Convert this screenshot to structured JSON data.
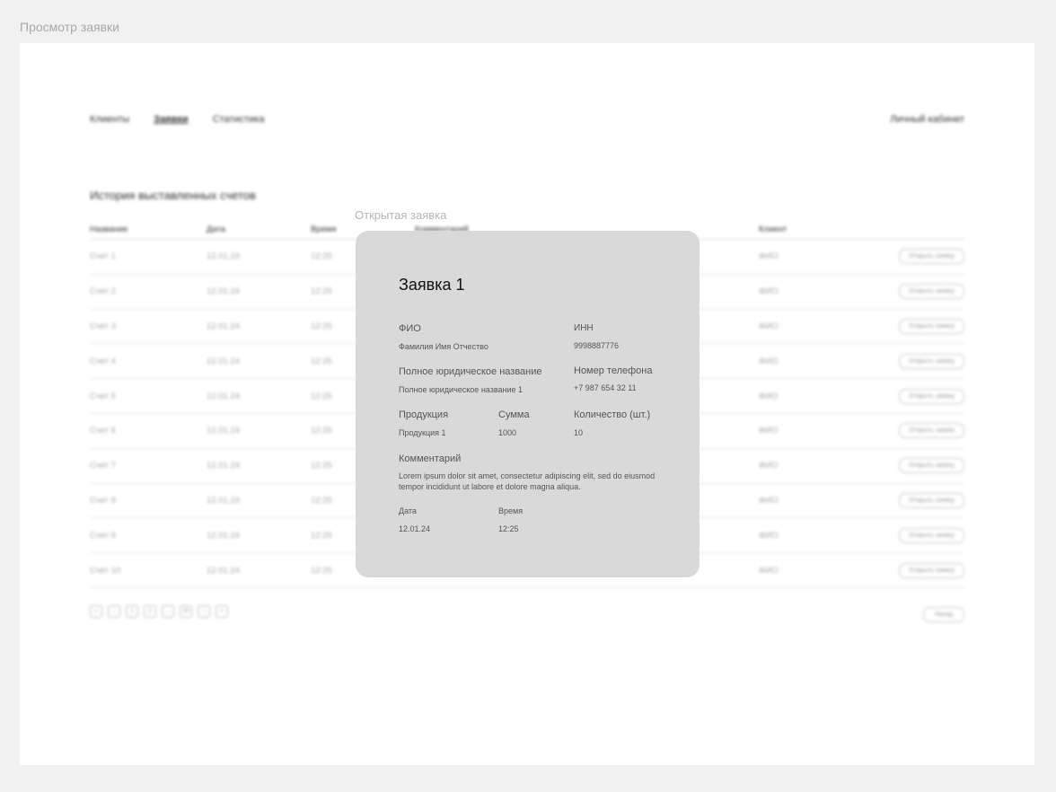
{
  "frame": {
    "title": "Просмотр заявки"
  },
  "nav": {
    "items": [
      "Клиенты",
      "Заявки",
      "Статистика"
    ],
    "active": "Заявки",
    "account": "Личный кабинет"
  },
  "invoices": {
    "title": "История выставленных счетов",
    "columns": [
      "Название",
      "Дата",
      "Время",
      "Комментарий",
      "Клиент"
    ],
    "rows": [
      {
        "name": "Счет 1",
        "date": "12.01.24",
        "time": "12:25",
        "client": "ФИО",
        "action": "Открыть заявку"
      },
      {
        "name": "Счет 2",
        "date": "12.01.24",
        "time": "12:25",
        "client": "ФИО",
        "action": "Открыть заявку"
      },
      {
        "name": "Счет 3",
        "date": "12.01.24",
        "time": "12:25",
        "client": "ФИО",
        "action": "Открыть заявку"
      },
      {
        "name": "Счет 4",
        "date": "12.01.24",
        "time": "12:25",
        "client": "ФИО",
        "action": "Открыть заявку"
      },
      {
        "name": "Счет 5",
        "date": "12.01.24",
        "time": "12:25",
        "client": "ФИО",
        "action": "Открыть заявку"
      },
      {
        "name": "Счет 6",
        "date": "12.01.24",
        "time": "12:25",
        "client": "ФИО",
        "action": "Открыть заявку"
      },
      {
        "name": "Счет 7",
        "date": "12.01.24",
        "time": "12:25",
        "client": "ФИО",
        "action": "Открыть заявку"
      },
      {
        "name": "Счет 8",
        "date": "12.01.24",
        "time": "12:25",
        "client": "ФИО",
        "action": "Открыть заявку"
      },
      {
        "name": "Счет 9",
        "date": "12.01.24",
        "time": "12:25",
        "client": "ФИО",
        "action": "Открыть заявку"
      },
      {
        "name": "Счет 10",
        "date": "12.01.24",
        "time": "12:25",
        "client": "ФИО",
        "action": "Открыть заявку"
      }
    ],
    "pagination": [
      "«",
      "‹",
      "1",
      "2",
      "…",
      "20",
      "›",
      "»"
    ],
    "back_label": "Назад"
  },
  "modal": {
    "caption": "Открытая заявка",
    "title": "Заявка 1",
    "fio_label": "ФИО",
    "fio_value": "Фамилия Имя Отчество",
    "inn_label": "ИНН",
    "inn_value": "9998887776",
    "legal_label": "Полное юридическое название",
    "legal_value": "Полное юридическое название 1",
    "phone_label": "Номер телефона",
    "phone_value": "+7 987 654 32 11",
    "product_label": "Продукция",
    "product_value": "Продукция 1",
    "sum_label": "Сумма",
    "sum_value": "1000",
    "qty_label": "Количество (шт.)",
    "qty_value": "10",
    "comment_label": "Комментарий",
    "comment_value": "Lorem ipsum dolor sit amet, consectetur adipiscing elit, sed do eiusmod tempor incididunt ut labore et dolore magna aliqua.",
    "date_label": "Дата",
    "date_value": "12.01.24",
    "time_label": "Время",
    "time_value": "12:25"
  }
}
